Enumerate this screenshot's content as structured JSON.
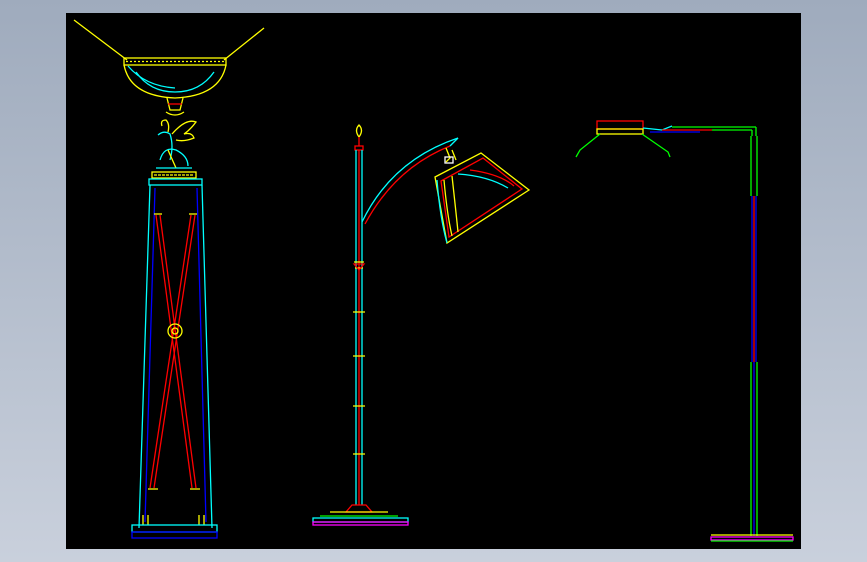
{
  "viewport": {
    "background_gradient": [
      "#9fabbd",
      "#c9d0dc"
    ],
    "canvas_color": "#000000"
  },
  "cad_colors": {
    "yellow": "#ffff00",
    "cyan": "#00ffff",
    "red": "#ff0000",
    "blue": "#0000ff",
    "green": "#00ff00",
    "magenta": "#ff00ff",
    "white": "#ffffff"
  },
  "drawing": {
    "objects": [
      {
        "id": "torchiere-lamp",
        "kind": "pedestal floor lamp with bowl shade and sphinx ornament"
      },
      {
        "id": "arc-floor-lamp",
        "kind": "arched floor lamp with tilted cone shade"
      },
      {
        "id": "angle-floor-lamp",
        "kind": "right-angle floor lamp with flat shade"
      }
    ]
  }
}
